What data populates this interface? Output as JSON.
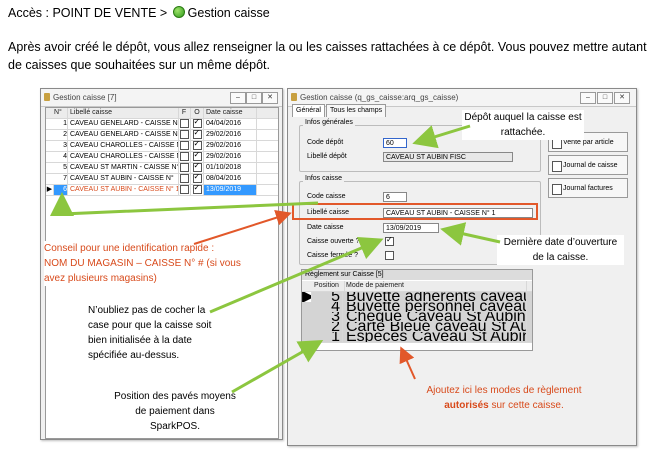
{
  "breadcrumb": {
    "prefix": "Accès : POINT DE VENTE >",
    "current": "Gestion caisse"
  },
  "intro": "Après avoir créé le dépôt, vous allez renseigner la ou les caisses rattachées à ce dépôt. Vous pouvez mettre autant de caisses que souhaitées sur un même dépôt.",
  "left_window": {
    "title": "Gestion caisse [7]",
    "columns": [
      "N°",
      "Libellé caisse",
      "F",
      "O",
      "Date caisse"
    ],
    "rows": [
      {
        "n": "1",
        "label": "CAVEAU GENELARD - CAISSE N°",
        "f": false,
        "o": true,
        "date": "04/04/2016"
      },
      {
        "n": "2",
        "label": "CAVEAU GENELARD - CAISSE N°",
        "f": false,
        "o": true,
        "date": "29/02/2016"
      },
      {
        "n": "3",
        "label": "CAVEAU CHAROLLES - CAISSE N°",
        "f": false,
        "o": true,
        "date": "29/02/2016"
      },
      {
        "n": "4",
        "label": "CAVEAU CHAROLLES - CAISSE N°",
        "f": false,
        "o": true,
        "date": "29/02/2016"
      },
      {
        "n": "5",
        "label": "CAVEAU ST MARTIN - CAISSE N°",
        "f": false,
        "o": true,
        "date": "01/10/2018"
      },
      {
        "n": "7",
        "label": "CAVEAU ST AUBIN - CAISSE N°",
        "f": false,
        "o": true,
        "date": "08/04/2016"
      },
      {
        "n": "6",
        "label": "CAVEAU ST AUBIN - CAISSE N° 1",
        "f": false,
        "o": true,
        "date": "13/09/2019"
      }
    ]
  },
  "right_window": {
    "title": "Gestion caisse (q_gs_caisse:arq_gs_caisse)",
    "tabs": [
      "Général",
      "Tous les champs"
    ],
    "infos_generales": {
      "title": "Infos générales",
      "code_depot_label": "Code dépôt",
      "code_depot_value": "60",
      "libelle_depot_label": "Libellé dépôt",
      "libelle_depot_value": "CAVEAU ST AUBIN FISC"
    },
    "infos_caisse": {
      "title": "Infos caisse",
      "code_label": "Code caisse",
      "code_value": "6",
      "libelle_label": "Libellé caisse",
      "libelle_value": "CAVEAU ST AUBIN - CAISSE N° 1",
      "date_label": "Date caisse",
      "date_value": "13/09/2019",
      "ouverte_label": "Caisse ouverte ?",
      "ouverte": true,
      "fermee_label": "Caisse fermée ?",
      "fermee": false
    },
    "side_buttons": [
      "Vente par article",
      "Journal de caisse",
      "Journal factures"
    ],
    "reglement": {
      "title": "Règlement sur Caisse [5]",
      "columns": [
        "Position",
        "Mode de paiement"
      ],
      "rows": [
        {
          "position": "5",
          "mode": "Buvette adherents caveau St Aubin"
        },
        {
          "position": "4",
          "mode": "Buvette personnel caveau St Aubin"
        },
        {
          "position": "3",
          "mode": "Chèque Caveau St Aubin"
        },
        {
          "position": "2",
          "mode": "Carte Bleue caveau St Aubin"
        },
        {
          "position": "1",
          "mode": "Espèces Caveau St Aubin"
        }
      ]
    }
  },
  "annotations": {
    "depot": "Dépôt auquel la caisse est rattachée.",
    "derniere_date": "Dernière date d’ouverture de la caisse.",
    "conseil_line1": "Conseil pour une identification rapide :",
    "conseil_line2": "NOM DU MAGASIN – CAISSE N° #  (si vous",
    "conseil_line3": "avez plusieurs magasins)",
    "cocher": "N’oubliez pas de cocher la case pour que la caisse soit bien initialisée à la date spécifiée au-dessus.",
    "position": "Position des pavés moyens de paiement dans SparkPOS.",
    "ajoutez_prefix": "Ajoutez ici les modes de règlement",
    "ajoutez_bold": "autorisés",
    "ajoutez_suffix": "sur cette caisse."
  },
  "colors": {
    "annotation_red": "#d84a1b",
    "arrow_green": "#8cc63f",
    "highlight_box": "#e2582a",
    "selection": "#3399ff"
  }
}
